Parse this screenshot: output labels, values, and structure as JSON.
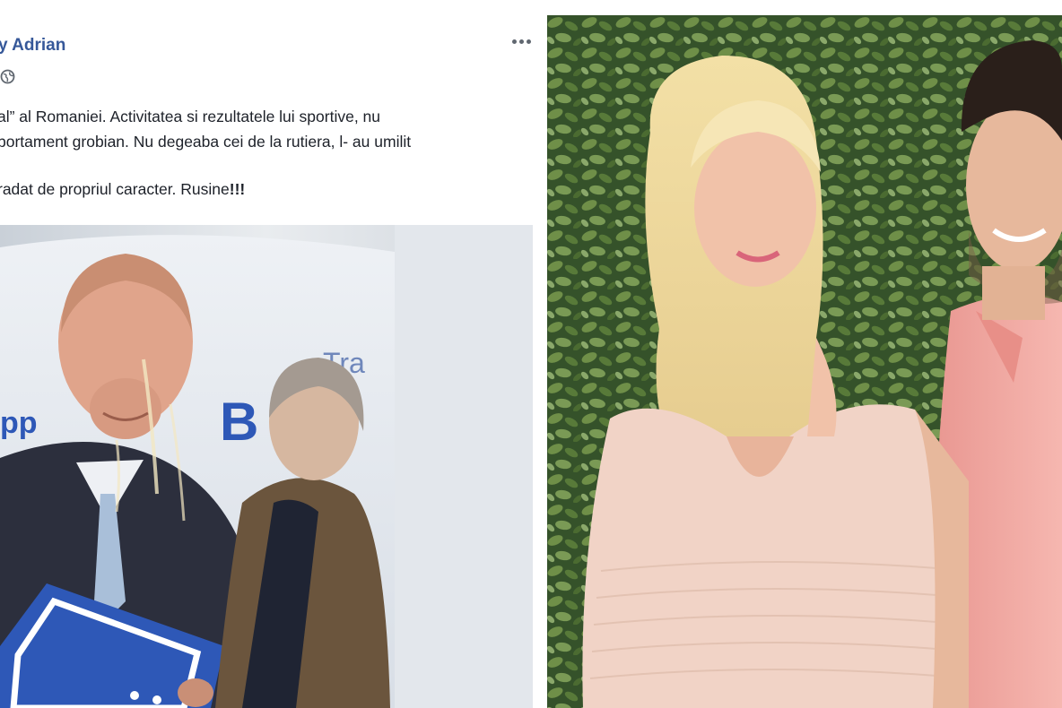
{
  "post": {
    "author_name": "y Adrian",
    "lines": [
      "al” al Romaniei. Activitatea si rezultatele lui sportive, nu",
      "portament grobian. Nu degeaba cei de la rutiera, l- au umilit",
      "",
      "radat de propriul caracter. Rusine"
    ],
    "emphasis": "!!!",
    "image_sign_text_left": "pp",
    "image_sign_text_center": "B",
    "image_sign_text_top": "Tra"
  },
  "colors": {
    "author_link": "#365899",
    "body_text": "#1d2129",
    "foliage_dark": "#2f4a22",
    "foliage_light": "#6f8f48",
    "shirt_pink": "#f3a8a3",
    "dress_nude": "#f1d3c6",
    "banner_blue": "#2e58b7"
  },
  "icons": {
    "more": "more-options-icon",
    "privacy": "globe-icon"
  }
}
